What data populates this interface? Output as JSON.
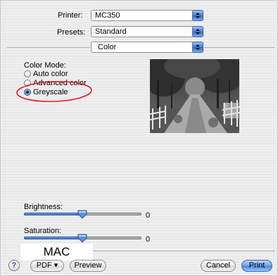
{
  "printer": {
    "label": "Printer:",
    "value": "MC350"
  },
  "presets": {
    "label": "Presets:",
    "value": "Standard"
  },
  "panel": {
    "value": "Color"
  },
  "color_mode": {
    "label": "Color Mode:",
    "options": [
      "Auto color",
      "Advanced color",
      "Greyscale"
    ],
    "selected": "Greyscale"
  },
  "brightness": {
    "label": "Brightness:",
    "value": "0",
    "level": 0.5
  },
  "saturation": {
    "label": "Saturation:",
    "value": "0",
    "level": 0.5
  },
  "overlay_label": "MAC",
  "buttons": {
    "help": "?",
    "pdf": "PDF ▾",
    "preview": "Preview",
    "cancel": "Cancel",
    "print": "Print"
  },
  "colors": {
    "annotation_circle": "#e31e24",
    "accent": "#3f7fd8"
  }
}
